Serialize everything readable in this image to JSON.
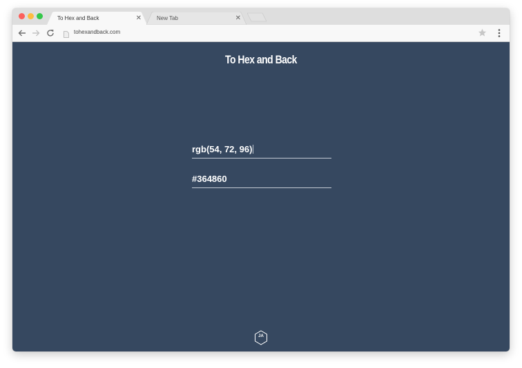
{
  "browser": {
    "tabs": [
      {
        "title": "To Hex and Back",
        "active": true
      },
      {
        "title": "New Tab",
        "active": false
      }
    ],
    "address_bar": {
      "url": "tohexandback.com"
    },
    "icons": [
      "back-arrow-icon",
      "forward-arrow-icon",
      "reload-icon",
      "page-icon",
      "star-icon",
      "kebab-menu-icon",
      "close-icon"
    ]
  },
  "page": {
    "title": "To Hex and Back",
    "rgb_field": {
      "value": "rgb(54, 72, 96)"
    },
    "hex_field": {
      "value": "#364860"
    },
    "footer_logo": {
      "text": "JA"
    }
  },
  "colors": {
    "background": "#364860",
    "field_underline": "#c3cad3",
    "traffic_red": "#fc605c",
    "traffic_yellow": "#fdbc40",
    "traffic_green": "#34c749"
  }
}
